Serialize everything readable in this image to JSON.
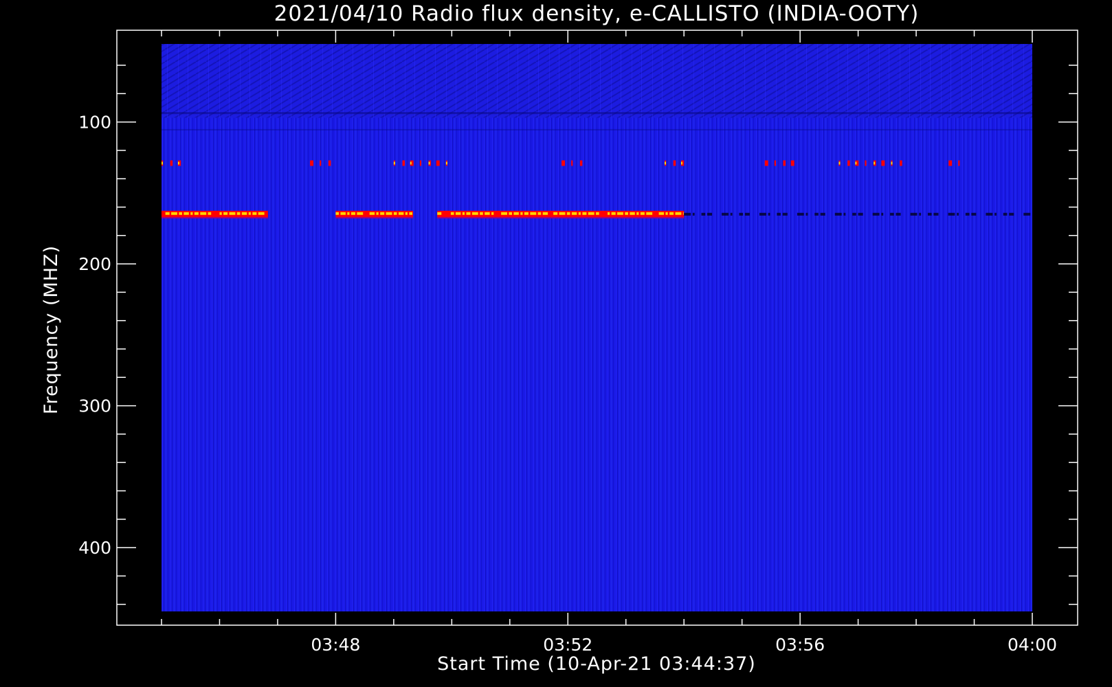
{
  "chart_data": {
    "type": "heatmap",
    "title": "2021/04/10  Radio flux density, e-CALLISTO (INDIA-OOTY)",
    "xlabel": "Start Time (10-Apr-21 03:44:37)",
    "ylabel": "Frequency (MHZ)",
    "x_axis": {
      "unit": "time",
      "range": [
        "03:45:00",
        "04:00:00"
      ],
      "ticks": [
        {
          "value": "03:48",
          "label": "03:48"
        },
        {
          "value": "03:52",
          "label": "03:52"
        },
        {
          "value": "03:56",
          "label": "03:56"
        },
        {
          "value": "04:00",
          "label": "04:00"
        }
      ]
    },
    "y_axis": {
      "unit": "MHz",
      "inverted": true,
      "range": [
        45,
        445
      ],
      "ticks": [
        {
          "value": 100,
          "label": "100"
        },
        {
          "value": 200,
          "label": "200"
        },
        {
          "value": 300,
          "label": "300"
        },
        {
          "value": 400,
          "label": "400"
        }
      ]
    },
    "grid": false,
    "legend": "none",
    "colors": {
      "background": "#000000",
      "baseline": "#1a1ae6",
      "low": "#0000ff",
      "mid": "#ff0000",
      "high": "#ffd700",
      "frame": "#ffffff"
    },
    "features": [
      {
        "name": "strong_band",
        "frequency_mhz": 165,
        "intensity": "high",
        "segments": [
          [
            "03:45:00",
            "03:46:50"
          ],
          [
            "03:48:00",
            "03:49:20"
          ],
          [
            "03:49:45",
            "03:54:00"
          ]
        ]
      },
      {
        "name": "weak_band",
        "frequency_mhz": 165,
        "intensity": "low-dark",
        "segments": [
          [
            "03:54:00",
            "04:00:00"
          ]
        ]
      },
      {
        "name": "intermittent_band",
        "frequency_mhz": 129,
        "intensity": "medium",
        "segments": [
          [
            "03:45:00",
            "03:45:20"
          ],
          [
            "03:47:30",
            "03:48:00"
          ],
          [
            "03:49:00",
            "03:50:00"
          ],
          [
            "03:51:50",
            "03:52:20"
          ],
          [
            "03:53:40",
            "03:54:00"
          ],
          [
            "03:55:20",
            "03:56:00"
          ],
          [
            "03:56:40",
            "03:57:50"
          ],
          [
            "03:58:30",
            "03:58:50"
          ]
        ]
      }
    ]
  }
}
